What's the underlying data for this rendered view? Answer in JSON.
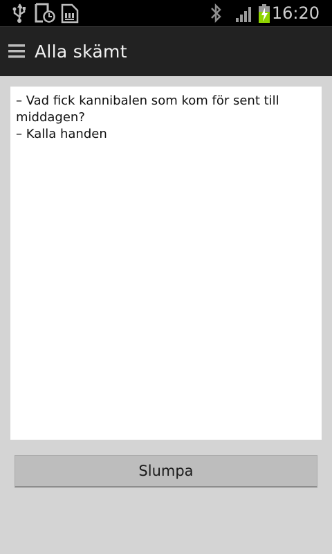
{
  "status_bar": {
    "time": "16:20",
    "icons": [
      "usb-icon",
      "alarm-icon",
      "sd-card-icon",
      "bluetooth-icon",
      "signal-icon",
      "battery-charging-icon"
    ]
  },
  "action_bar": {
    "title": "Alla skämt",
    "menu_icon": "hamburger-menu-icon"
  },
  "joke": {
    "lines": [
      "– Vad fick kannibalen som kom för sent till middagen?",
      "– Kalla handen"
    ]
  },
  "actions": {
    "random_label": "Slumpa"
  },
  "colors": {
    "status_bar": "#000000",
    "action_bar": "#222222",
    "background": "#d4d4d4",
    "card": "#ffffff",
    "button": "#bdbdbd",
    "battery_charge": "#8fd400"
  }
}
